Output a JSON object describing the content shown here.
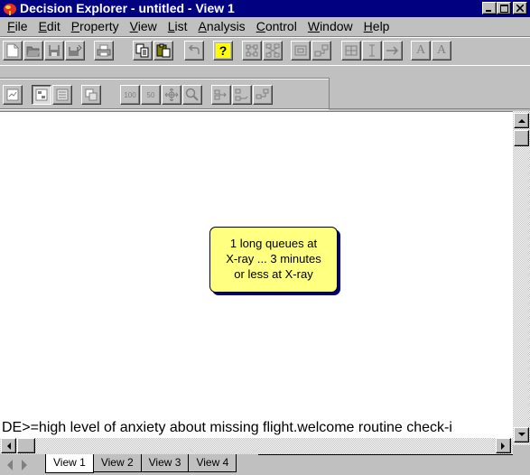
{
  "window": {
    "title": "Decision Explorer - untitled - View 1",
    "controls": {
      "minimize": "_",
      "maximize": "□",
      "close": "✕"
    }
  },
  "menu": [
    {
      "label": "File",
      "key": "F",
      "rest": "ile"
    },
    {
      "label": "Edit",
      "key": "E",
      "rest": "dit"
    },
    {
      "label": "Property",
      "key": "P",
      "rest": "roperty"
    },
    {
      "label": "View",
      "key": "V",
      "rest": "iew"
    },
    {
      "label": "List",
      "key": "L",
      "rest": "ist"
    },
    {
      "label": "Analysis",
      "key": "A",
      "rest": "nalysis"
    },
    {
      "label": "Control",
      "key": "C",
      "rest": "ontrol"
    },
    {
      "label": "Window",
      "key": "W",
      "rest": "indow"
    },
    {
      "label": "Help",
      "key": "H",
      "rest": "elp"
    }
  ],
  "toolbar1": [
    "new",
    "open",
    "save",
    "save-as",
    "print",
    "copy",
    "paste",
    "undo",
    "help",
    "grid-layout",
    "map-layout",
    "frame",
    "link",
    "table",
    "font-size",
    "arrow",
    "font-larger",
    "font-smaller"
  ],
  "toolbar1_labels": {
    "help": "?",
    "font_larger": "A",
    "font_smaller": "A"
  },
  "toolbar2": [
    "concept-properties",
    "view-a",
    "view-b",
    "copy-view",
    "numbers-concepts",
    "numbers-links",
    "move",
    "zoom",
    "arrange-1",
    "arrange-2",
    "arrange-3"
  ],
  "toolbar2_labels": {
    "numbers_concepts": "100",
    "numbers_links": "50"
  },
  "map": {
    "node": {
      "text": "1 long queues at\nX-ray ... 3 minutes\nor less at X-ray"
    }
  },
  "status_text": "DE>=high level of anxiety about missing flight.welcome routine check-i",
  "tabs": [
    {
      "label": "View 1",
      "active": true
    },
    {
      "label": "View 2",
      "active": false
    },
    {
      "label": "View 3",
      "active": false
    },
    {
      "label": "View 4",
      "active": false
    }
  ],
  "colors": {
    "titlebar": "#000080",
    "node_fill": "#ffff80",
    "node_shadow": "#000080",
    "face": "#c0c0c0"
  }
}
